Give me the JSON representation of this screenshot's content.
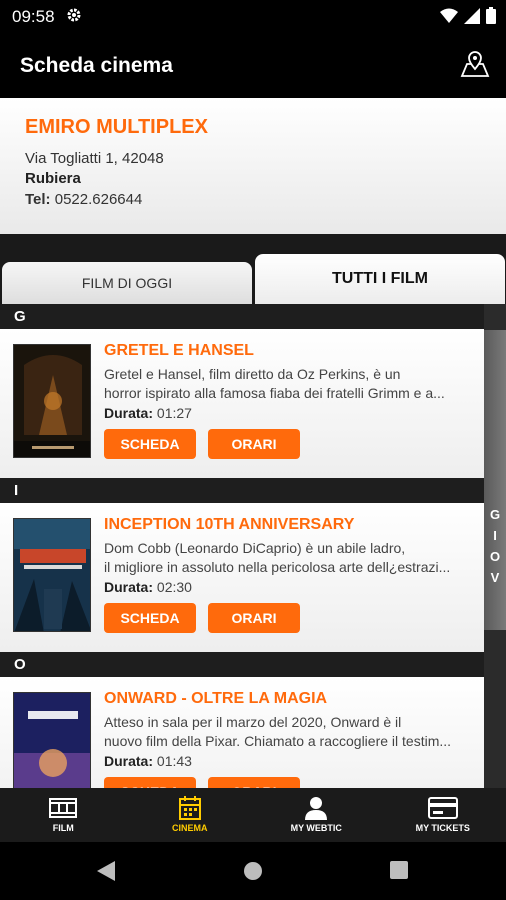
{
  "status": {
    "time": "09:58"
  },
  "app_bar": {
    "title": "Scheda cinema"
  },
  "cinema": {
    "name": "EMIRO MULTIPLEX",
    "address": "Via Togliatti 1, 42048",
    "city": "Rubiera",
    "tel_label": "Tel:",
    "tel": "0522.626644"
  },
  "tabs": {
    "today": "FILM DI OGGI",
    "all": "TUTTI I FILM"
  },
  "sections": [
    {
      "letter": "G",
      "film": {
        "title": "GRETEL E HANSEL",
        "desc1": "Gretel e Hansel, film diretto da Oz Perkins, è un",
        "desc2": "horror ispirato alla famosa fiaba dei fratelli Grimm e a...",
        "dur_label": "Durata:",
        "dur": "01:27",
        "scheda": "SCHEDA",
        "orari": "ORARI"
      }
    },
    {
      "letter": "I",
      "film": {
        "title": "INCEPTION 10TH ANNIVERSARY",
        "desc1": "Dom Cobb (Leonardo DiCaprio) è un abile ladro,",
        "desc2": "il migliore in assoluto nella pericolosa arte dell¿estrazi...",
        "dur_label": "Durata:",
        "dur": "02:30",
        "scheda": "SCHEDA",
        "orari": "ORARI"
      }
    },
    {
      "letter": "O",
      "film": {
        "title": "ONWARD - OLTRE LA MAGIA",
        "desc1": "Atteso in sala per il marzo del 2020, Onward è il",
        "desc2": "nuovo film della Pixar. Chiamato a raccogliere il testim...",
        "dur_label": "Durata:",
        "dur": "01:43",
        "scheda": "SCHEDA",
        "orari": "ORARI"
      }
    }
  ],
  "side_index": [
    "G",
    "I",
    "O",
    "V"
  ],
  "nav": {
    "film": "FILM",
    "cinema": "CINEMA",
    "webtic": "MY WEBTIC",
    "tickets": "MY TICKETS"
  },
  "colors": {
    "accent": "#ff6a0c",
    "nav_active": "#ffcc00"
  }
}
